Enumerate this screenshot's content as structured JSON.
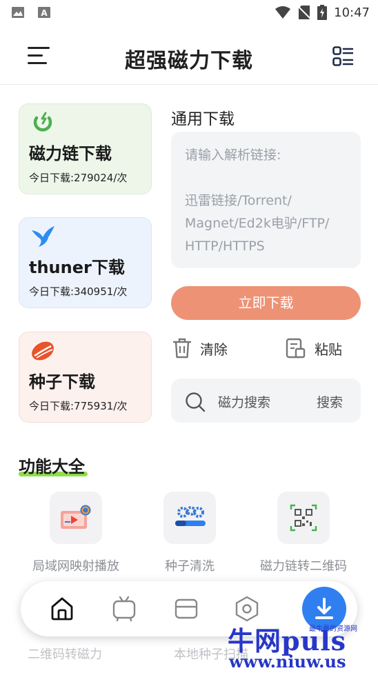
{
  "status_bar": {
    "time": "10:47"
  },
  "header": {
    "title": "超强磁力下载"
  },
  "cards": [
    {
      "name": "磁力链下载",
      "count": "今日下载:279024/次",
      "icon": "magnet-icon",
      "color": "#4caf50"
    },
    {
      "name": "thuner下载",
      "count": "今日下载:340951/次",
      "icon": "bird-icon",
      "color": "#2d8cf0"
    },
    {
      "name": "种子下载",
      "count": "今日下载:775931/次",
      "icon": "seed-icon",
      "color": "#e8542c"
    }
  ],
  "general": {
    "title": "通用下载",
    "placeholder": "请输入解析链接:\n\n迅雷链接/Torrent/\nMagnet/Ed2k电驴/FTP/\nHTTP/HTTPS",
    "download_button": "立即下载",
    "clear_label": "清除",
    "paste_label": "粘贴",
    "search_placeholder": "磁力搜索",
    "search_button": "搜索"
  },
  "features": {
    "title": "功能大全",
    "items": [
      {
        "label": "局域网映射播放",
        "icon": "screen-cast-icon"
      },
      {
        "label": "种子清洗",
        "icon": "gears-icon"
      },
      {
        "label": "磁力链转二维码",
        "icon": "qr-code-icon"
      }
    ],
    "partial_items": [
      "二维码转磁力",
      "本地种子扫描"
    ]
  },
  "tabbar": {
    "items": [
      "home-icon",
      "tv-icon",
      "card-icon",
      "settings-icon",
      "download-icon"
    ]
  },
  "watermark": {
    "main": "牛网puls",
    "sub": "最牛最的资源网",
    "url": "www.niuw.us"
  },
  "colors": {
    "accent_button": "#ee9275",
    "fab": "#2f7ff1",
    "highlight": "#8fde4c"
  }
}
